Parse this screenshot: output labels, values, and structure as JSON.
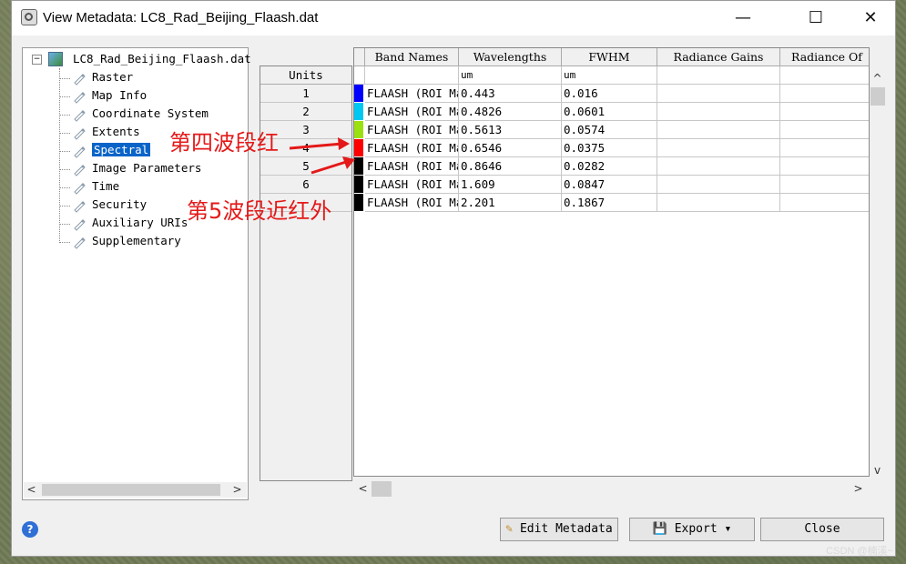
{
  "window": {
    "title": "View Metadata: LC8_Rad_Beijing_Flaash.dat"
  },
  "controls": {
    "minimize": "—",
    "maximize": "☐",
    "close": "✕"
  },
  "tree": {
    "root": "LC8_Rad_Beijing_Flaash.dat",
    "items": [
      {
        "label": "Raster",
        "icon": "tag-icon"
      },
      {
        "label": "Map Info",
        "icon": "map-tag-icon"
      },
      {
        "label": "Coordinate System",
        "icon": "coord-tag-icon"
      },
      {
        "label": "Extents",
        "icon": "extents-tag-icon"
      },
      {
        "label": "Spectral",
        "icon": "spectral-tag-icon",
        "selected": true
      },
      {
        "label": "Image Parameters",
        "icon": "tag-icon"
      },
      {
        "label": "Time",
        "icon": "clock-tag-icon"
      },
      {
        "label": "Security",
        "icon": "tag-icon"
      },
      {
        "label": "Auxiliary URIs",
        "icon": "tag-icon"
      },
      {
        "label": "Supplementary",
        "icon": "tag-icon"
      }
    ]
  },
  "table": {
    "headers": [
      "Band Names",
      "Wavelengths",
      "FWHM",
      "Radiance Gains",
      "Radiance Of"
    ],
    "units_label": "Units",
    "units": [
      "",
      "um",
      "um",
      "",
      ""
    ],
    "rows": [
      {
        "index": "1",
        "color": "#0000ff",
        "band": "FLAASH (ROI Ma",
        "wavelength": "0.443",
        "fwhm": "0.016"
      },
      {
        "index": "2",
        "color": "#00c8f0",
        "band": "FLAASH (ROI Ma",
        "wavelength": "0.4826",
        "fwhm": "0.0601"
      },
      {
        "index": "3",
        "color": "#9be011",
        "band": "FLAASH (ROI Ma",
        "wavelength": "0.5613",
        "fwhm": "0.0574"
      },
      {
        "index": "4",
        "color": "#ff0000",
        "band": "FLAASH (ROI Ma",
        "wavelength": "0.6546",
        "fwhm": "0.0375"
      },
      {
        "index": "5",
        "color": "#000000",
        "band": "FLAASH (ROI Ma",
        "wavelength": "0.8646",
        "fwhm": "0.0282"
      },
      {
        "index": "6",
        "color": "#000000",
        "band": "FLAASH (ROI Ma",
        "wavelength": "1.609",
        "fwhm": "0.0847"
      },
      {
        "index": "",
        "color": "#000000",
        "band": "FLAASH (ROI Ma",
        "wavelength": "2.201",
        "fwhm": "0.1867"
      }
    ]
  },
  "buttons": {
    "edit": "Edit Metadata",
    "export": "Export",
    "close": "Close"
  },
  "annotations": {
    "red_band": "第四波段红",
    "nir_band": "第5波段近红外"
  },
  "watermark": "CSDN @楠溪~"
}
